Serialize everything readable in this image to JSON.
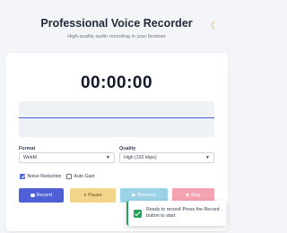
{
  "header": {
    "title": "Professional Voice Recorder",
    "subtitle": "High-quality audio recording in your browser",
    "theme_icon": "moon-icon"
  },
  "recorder": {
    "timer": "00:00:00",
    "format": {
      "label": "Format",
      "value": "WebM"
    },
    "quality": {
      "label": "Quality",
      "value": "High (192 kbps)"
    },
    "options": [
      {
        "label": "Noise Reduction",
        "checked": true
      },
      {
        "label": "Auto Gain",
        "checked": false
      }
    ],
    "buttons": {
      "record": "Record",
      "pause": "Pause",
      "resume": "Resume",
      "stop": "Stop"
    }
  },
  "toast": {
    "message": "Ready to record! Press the Record button to start."
  },
  "colors": {
    "accent": "#4f5fd6",
    "pause": "#f4d48a",
    "resume": "#9ad3e6",
    "stop": "#f4a3b0",
    "success": "#22a35a"
  }
}
